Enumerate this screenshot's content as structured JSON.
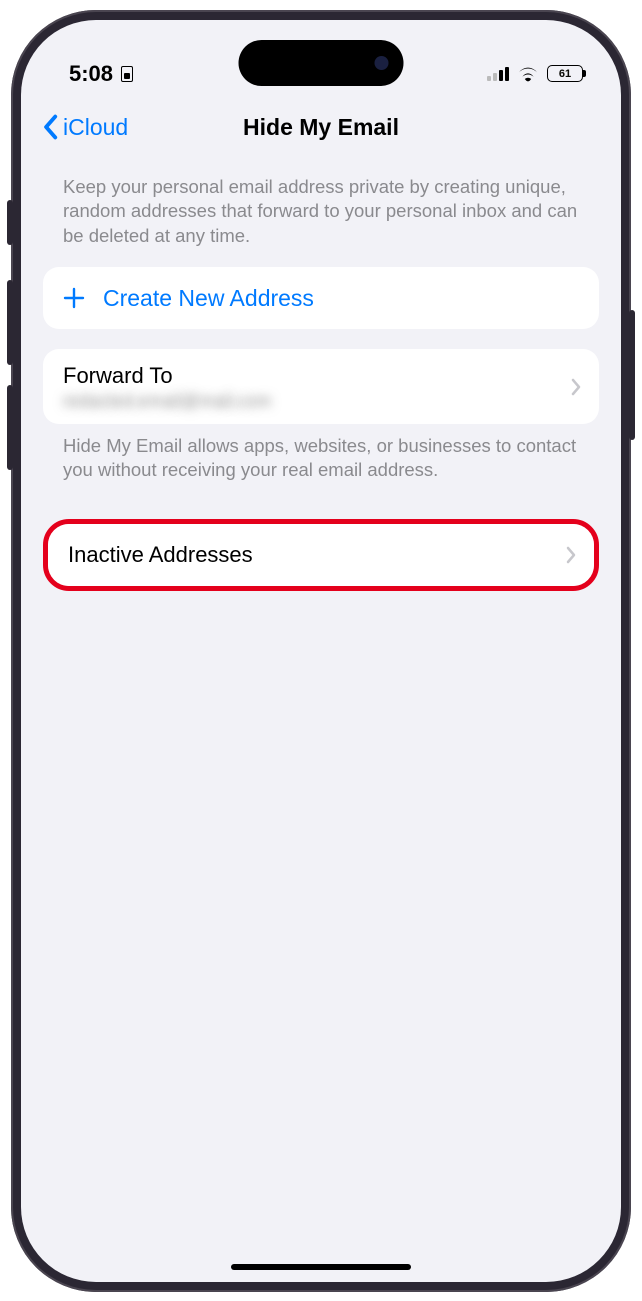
{
  "status": {
    "time": "5:08",
    "battery_level": "61"
  },
  "nav": {
    "back_label": "iCloud",
    "title": "Hide My Email"
  },
  "intro": "Keep your personal email address private by creating unique, random addresses that forward to your personal inbox and can be deleted at any time.",
  "create_label": "Create New Address",
  "forward": {
    "label": "Forward To",
    "value": "redacted.email@mail.com"
  },
  "forward_footer": "Hide My Email allows apps, websites, or businesses to contact you without receiving your real email address.",
  "inactive_label": "Inactive Addresses"
}
